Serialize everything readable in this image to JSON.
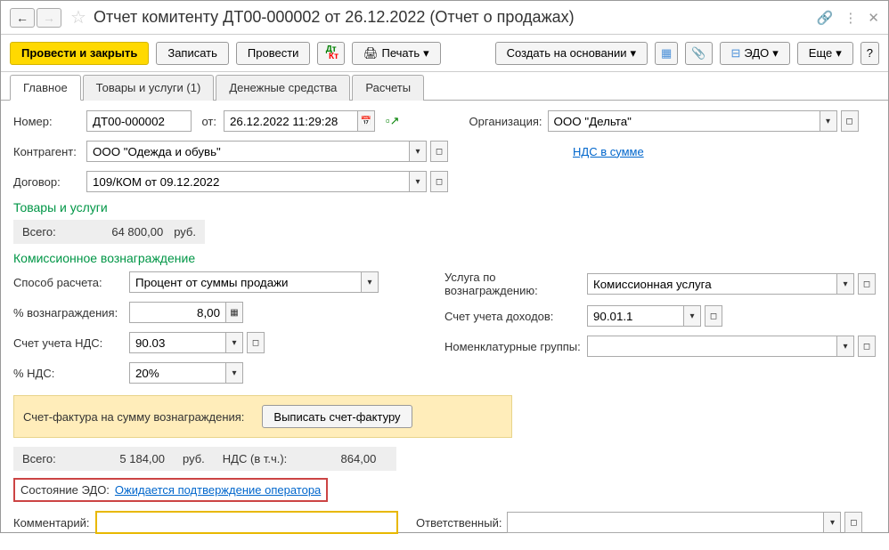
{
  "titlebar": {
    "title": "Отчет комитенту ДТ00-000002 от 26.12.2022 (Отчет о продажах)"
  },
  "toolbar": {
    "submit_close": "Провести и закрыть",
    "save": "Записать",
    "submit": "Провести",
    "print": "Печать",
    "create_based": "Создать на основании",
    "edo": "ЭДО",
    "more": "Еще"
  },
  "tabs": {
    "main": "Главное",
    "goods": "Товары и услуги (1)",
    "money": "Денежные средства",
    "calc": "Расчеты"
  },
  "header": {
    "number_label": "Номер:",
    "number": "ДТ00-000002",
    "date_label": "от:",
    "date": "26.12.2022 11:29:28",
    "org_label": "Организация:",
    "org": "ООО \"Дельта\"",
    "counterparty_label": "Контрагент:",
    "counterparty": "ООО \"Одежда и обувь\"",
    "vat_link": "НДС в сумме",
    "contract_label": "Договор:",
    "contract": "109/КОМ от 09.12.2022"
  },
  "goods": {
    "section": "Товары и услуги",
    "total_label": "Всего:",
    "total": "64 800,00",
    "currency": "руб."
  },
  "commission": {
    "section": "Комиссионное вознаграждение",
    "method_label": "Способ расчета:",
    "method": "Процент от суммы продажи",
    "percent_label": "% вознаграждения:",
    "percent": "8,00",
    "vat_acc_label": "Счет учета НДС:",
    "vat_acc": "90.03",
    "vat_pct_label": "% НДС:",
    "vat_pct": "20%",
    "service_label": "Услуга по вознаграждению:",
    "service": "Комиссионная услуга",
    "income_acc_label": "Счет учета доходов:",
    "income_acc": "90.01.1",
    "nom_label": "Номенклатурные группы:",
    "nom": "",
    "invoice_note": "Счет-фактура на сумму вознаграждения:",
    "invoice_btn": "Выписать счет-фактуру",
    "total_label": "Всего:",
    "total": "5 184,00",
    "currency": "руб.",
    "vat_incl_label": "НДС (в т.ч.):",
    "vat_incl": "864,00"
  },
  "footer": {
    "edo_label": "Состояние ЭДО:",
    "edo_status": "Ожидается подтверждение оператора",
    "comment_label": "Комментарий:",
    "responsible_label": "Ответственный:"
  }
}
